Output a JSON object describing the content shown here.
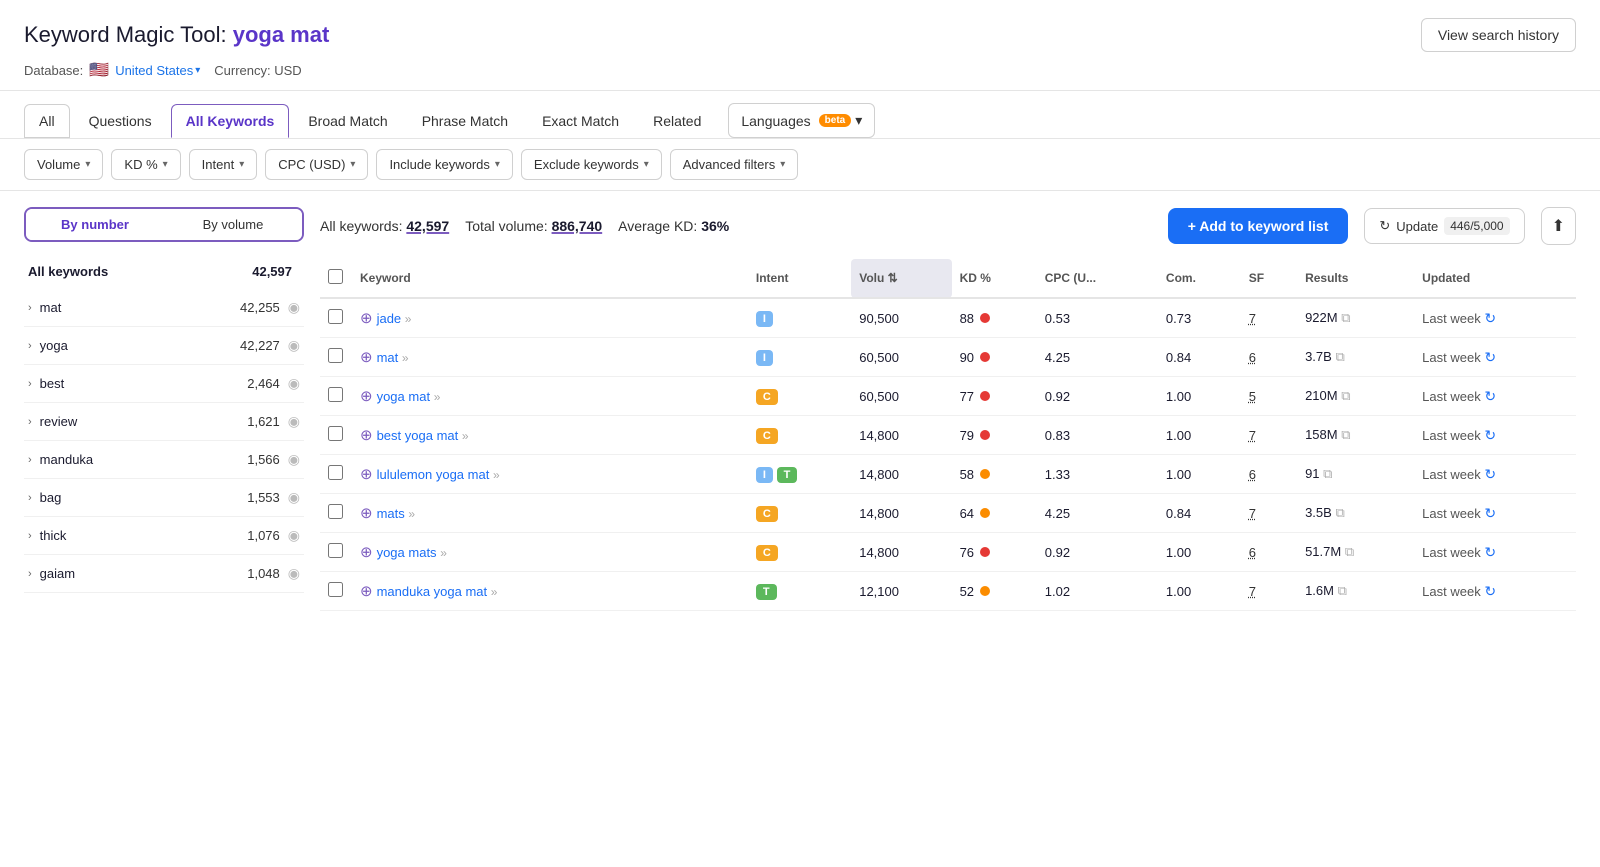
{
  "header": {
    "title_prefix": "Keyword Magic Tool:",
    "title_keyword": "yoga mat",
    "view_history_label": "View search history",
    "db_label": "Database:",
    "db_country": "United States",
    "currency_label": "Currency: USD"
  },
  "tabs": {
    "items": [
      {
        "id": "all",
        "label": "All",
        "active": false,
        "tab_all": true
      },
      {
        "id": "questions",
        "label": "Questions",
        "active": false
      },
      {
        "id": "all-keywords",
        "label": "All Keywords",
        "active": true
      },
      {
        "id": "broad-match",
        "label": "Broad Match",
        "active": false
      },
      {
        "id": "phrase-match",
        "label": "Phrase Match",
        "active": false
      },
      {
        "id": "exact-match",
        "label": "Exact Match",
        "active": false
      },
      {
        "id": "related",
        "label": "Related",
        "active": false
      }
    ],
    "languages_label": "Languages",
    "languages_beta": "beta"
  },
  "filters": [
    {
      "id": "volume",
      "label": "Volume"
    },
    {
      "id": "kd",
      "label": "KD %"
    },
    {
      "id": "intent",
      "label": "Intent"
    },
    {
      "id": "cpc",
      "label": "CPC (USD)"
    },
    {
      "id": "include-keywords",
      "label": "Include keywords"
    },
    {
      "id": "exclude-keywords",
      "label": "Exclude keywords"
    },
    {
      "id": "advanced-filters",
      "label": "Advanced filters"
    }
  ],
  "sidebar": {
    "tab_by_number": "By number",
    "tab_by_volume": "By volume",
    "all_label": "All keywords",
    "all_count": "42,597",
    "items": [
      {
        "label": "mat",
        "count": "42,255"
      },
      {
        "label": "yoga",
        "count": "42,227"
      },
      {
        "label": "best",
        "count": "2,464"
      },
      {
        "label": "review",
        "count": "1,621"
      },
      {
        "label": "manduka",
        "count": "1,566"
      },
      {
        "label": "bag",
        "count": "1,553"
      },
      {
        "label": "thick",
        "count": "1,076"
      },
      {
        "label": "gaiam",
        "count": "1,048"
      }
    ]
  },
  "content": {
    "all_keywords_label": "All keywords:",
    "all_keywords_count": "42,597",
    "total_volume_label": "Total volume:",
    "total_volume_value": "886,740",
    "avg_kd_label": "Average KD:",
    "avg_kd_value": "36%",
    "add_keyword_btn": "+ Add to keyword list",
    "update_btn": "Update",
    "update_count": "446/5,000",
    "table": {
      "columns": [
        "",
        "Keyword",
        "Intent",
        "Volume",
        "KD %",
        "CPC (U...",
        "Com.",
        "SF",
        "Results",
        "Updated"
      ],
      "rows": [
        {
          "keyword": "jade",
          "intent": [
            "I"
          ],
          "volume": "90,500",
          "kd": "88",
          "kd_color": "red",
          "cpc": "0.53",
          "com": "0.73",
          "sf": "7",
          "results": "922M",
          "updated": "Last week"
        },
        {
          "keyword": "mat",
          "intent": [
            "I"
          ],
          "volume": "60,500",
          "kd": "90",
          "kd_color": "red",
          "cpc": "4.25",
          "com": "0.84",
          "sf": "6",
          "results": "3.7B",
          "updated": "Last week"
        },
        {
          "keyword": "yoga mat",
          "intent": [
            "C"
          ],
          "volume": "60,500",
          "kd": "77",
          "kd_color": "red",
          "cpc": "0.92",
          "com": "1.00",
          "sf": "5",
          "results": "210M",
          "updated": "Last week"
        },
        {
          "keyword": "best yoga mat",
          "intent": [
            "C"
          ],
          "volume": "14,800",
          "kd": "79",
          "kd_color": "red",
          "cpc": "0.83",
          "com": "1.00",
          "sf": "7",
          "results": "158M",
          "updated": "Last week"
        },
        {
          "keyword": "lululemon yoga mat",
          "intent": [
            "I",
            "T"
          ],
          "volume": "14,800",
          "kd": "58",
          "kd_color": "orange",
          "cpc": "1.33",
          "com": "1.00",
          "sf": "6",
          "results": "91",
          "updated": "Last week"
        },
        {
          "keyword": "mats",
          "intent": [
            "C"
          ],
          "volume": "14,800",
          "kd": "64",
          "kd_color": "orange",
          "cpc": "4.25",
          "com": "0.84",
          "sf": "7",
          "results": "3.5B",
          "updated": "Last week"
        },
        {
          "keyword": "yoga mats",
          "intent": [
            "C"
          ],
          "volume": "14,800",
          "kd": "76",
          "kd_color": "red",
          "cpc": "0.92",
          "com": "1.00",
          "sf": "6",
          "results": "51.7M",
          "updated": "Last week"
        },
        {
          "keyword": "manduka yoga mat",
          "intent": [
            "T"
          ],
          "volume": "12,100",
          "kd": "52",
          "kd_color": "orange",
          "cpc": "1.02",
          "com": "1.00",
          "sf": "7",
          "results": "1.6M",
          "updated": "Last week"
        }
      ]
    }
  },
  "icons": {
    "chevron_down": "▾",
    "chevron_right": "›",
    "eye": "◉",
    "add_circle": "⊕",
    "double_arrow": "»",
    "refresh": "↻",
    "external": "⧉",
    "export": "⬆",
    "sort": "⇅"
  }
}
